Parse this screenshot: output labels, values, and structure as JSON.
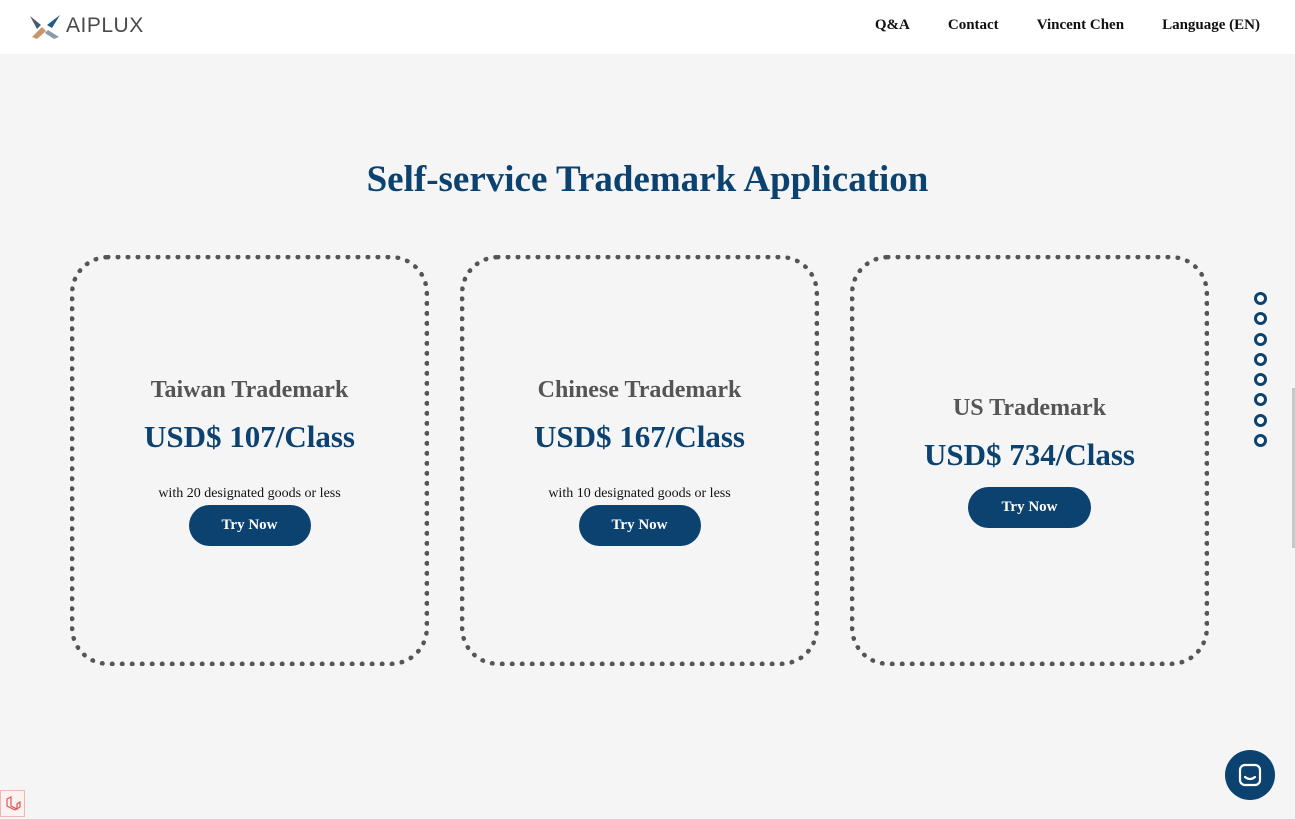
{
  "brand": {
    "name": "AIPLUX",
    "colors": {
      "primary": "#0b4270",
      "card_border": "#555555",
      "background": "#f5f5f6"
    }
  },
  "nav": {
    "items": [
      "Q&A",
      "Contact",
      "Vincent Chen",
      "Language (EN)"
    ]
  },
  "page": {
    "title": "Self-service Trademark Application"
  },
  "cards": [
    {
      "title": "Taiwan Trademark",
      "price": "USD$ 107/Class",
      "note": "with 20 designated goods or less",
      "button": "Try Now"
    },
    {
      "title": "Chinese Trademark",
      "price": "USD$ 167/Class",
      "note": "with 10 designated goods or less",
      "button": "Try Now"
    },
    {
      "title": "US Trademark",
      "price": "USD$ 734/Class",
      "button": "Try Now"
    }
  ],
  "section_nav": {
    "dot_count": 8
  },
  "icons": {
    "logo": "aiplux-logo-icon",
    "chat": "chat-icon",
    "corner": "laravel-icon"
  }
}
